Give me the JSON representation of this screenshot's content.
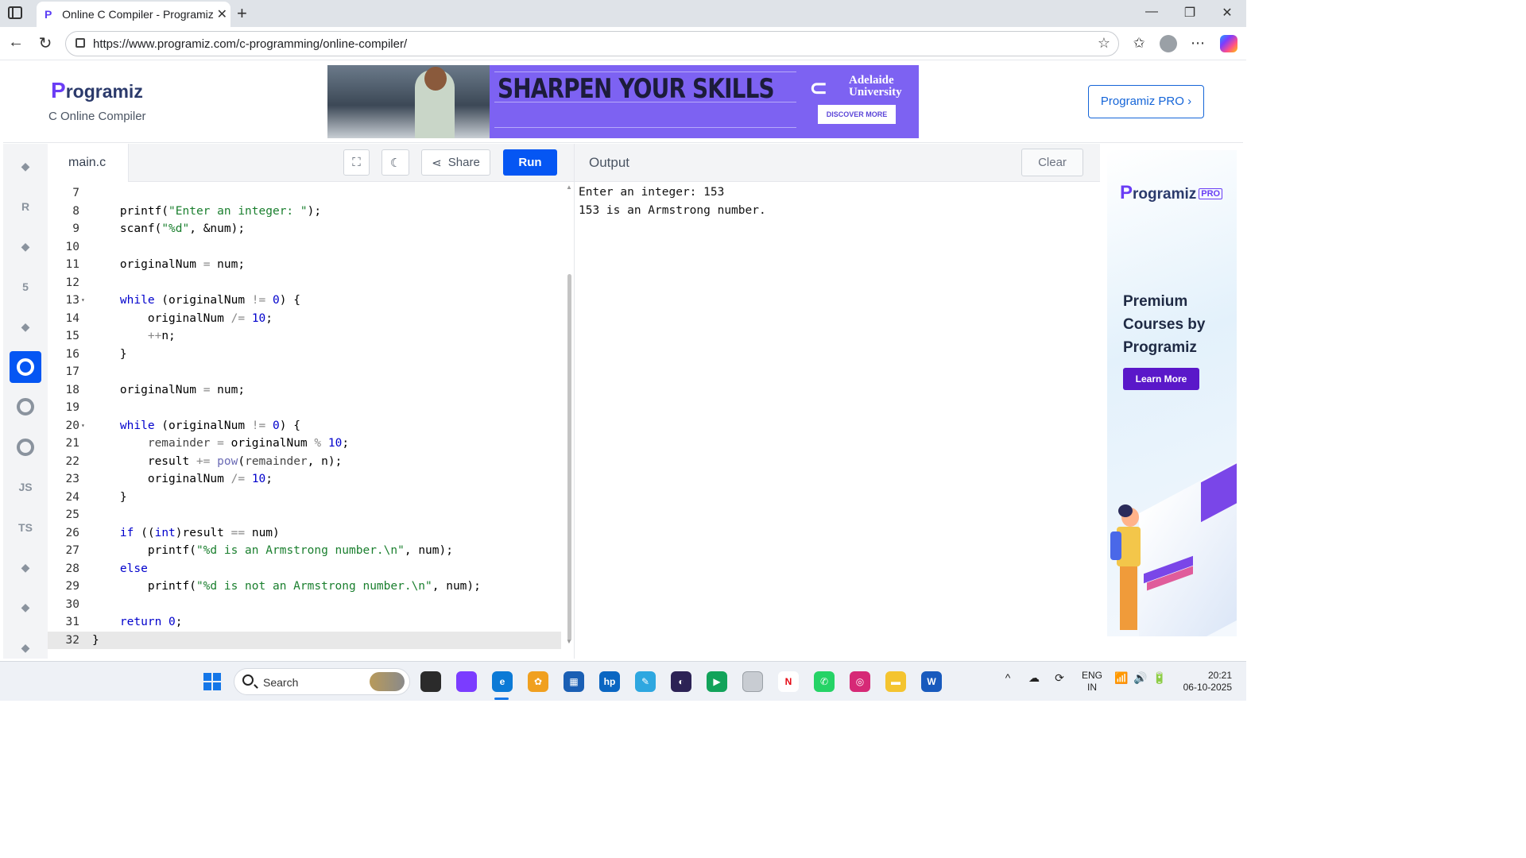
{
  "browser": {
    "tab_title": "Online C Compiler - Programiz",
    "tab_close": "✕",
    "new_tab": "+",
    "url": "https://www.programiz.com/c-programming/online-compiler/",
    "window_controls": [
      "—",
      "❐",
      "✕"
    ],
    "nav": [
      "←",
      "↻"
    ],
    "toolbar_icons": [
      "☆",
      "✩",
      "⋯"
    ]
  },
  "header": {
    "logo_initial": "P",
    "logo_rest": "rogramiz",
    "subtitle": "C Online Compiler",
    "pro_button": "Programiz PRO ›"
  },
  "banner": {
    "headline": "SHARPEN YOUR SKILLS",
    "university_line1": "Adelaide",
    "university_line2": "University",
    "cta": "DISCOVER MORE"
  },
  "sidebar": {
    "items": [
      {
        "name": "python",
        "label": "",
        "active": false
      },
      {
        "name": "r",
        "label": "R",
        "active": false
      },
      {
        "name": "sql",
        "label": "",
        "active": false
      },
      {
        "name": "html",
        "label": "5",
        "active": false
      },
      {
        "name": "java",
        "label": "",
        "active": false
      },
      {
        "name": "c",
        "label": "C",
        "active": true
      },
      {
        "name": "cpp",
        "label": "C",
        "active": false
      },
      {
        "name": "csharp",
        "label": "C",
        "active": false
      },
      {
        "name": "js",
        "label": "JS",
        "active": false
      },
      {
        "name": "ts",
        "label": "TS",
        "active": false
      },
      {
        "name": "go",
        "label": "",
        "active": false
      },
      {
        "name": "swift",
        "label": "",
        "active": false
      },
      {
        "name": "rust",
        "label": "",
        "active": false
      }
    ]
  },
  "editor": {
    "filename": "main.c",
    "share_label": "Share",
    "run_label": "Run",
    "lines": [
      {
        "n": "7",
        "fold": false,
        "html": ""
      },
      {
        "n": "8",
        "fold": false,
        "html": "    printf(<span class=\"str\">\"Enter an integer: \"</span>);"
      },
      {
        "n": "9",
        "fold": false,
        "html": "    scanf(<span class=\"str\">\"%d\"</span>, &amp;num);"
      },
      {
        "n": "10",
        "fold": false,
        "html": ""
      },
      {
        "n": "11",
        "fold": false,
        "html": "    originalNum <span class=\"op\">=</span> num;"
      },
      {
        "n": "12",
        "fold": false,
        "html": ""
      },
      {
        "n": "13",
        "fold": true,
        "html": "    <span class=\"kw\">while</span> (originalNum <span class=\"op\">!=</span> <span class=\"num\">0</span>) {"
      },
      {
        "n": "14",
        "fold": false,
        "html": "        originalNum <span class=\"op\">/=</span> <span class=\"num\">10</span>;"
      },
      {
        "n": "15",
        "fold": false,
        "html": "        <span class=\"op\">++</span>n;"
      },
      {
        "n": "16",
        "fold": false,
        "html": "    }"
      },
      {
        "n": "17",
        "fold": false,
        "html": ""
      },
      {
        "n": "18",
        "fold": false,
        "html": "    originalNum <span class=\"op\">=</span> num;"
      },
      {
        "n": "19",
        "fold": false,
        "html": ""
      },
      {
        "n": "20",
        "fold": true,
        "html": "    <span class=\"kw\">while</span> (originalNum <span class=\"op\">!=</span> <span class=\"num\">0</span>) {"
      },
      {
        "n": "21",
        "fold": false,
        "html": "        <span class=\"idn\">remainder</span> <span class=\"op\">=</span> originalNum <span class=\"op\">%</span> <span class=\"num\">10</span>;"
      },
      {
        "n": "22",
        "fold": false,
        "html": "        result <span class=\"op\">+=</span> <span class=\"fn\">pow</span>(<span class=\"idn\">remainder</span>, n);"
      },
      {
        "n": "23",
        "fold": false,
        "html": "        originalNum <span class=\"op\">/=</span> <span class=\"num\">10</span>;"
      },
      {
        "n": "24",
        "fold": false,
        "html": "    }"
      },
      {
        "n": "25",
        "fold": false,
        "html": ""
      },
      {
        "n": "26",
        "fold": false,
        "html": "    <span class=\"kw\">if</span> ((<span class=\"kw\">int</span>)result <span class=\"op\">==</span> num)"
      },
      {
        "n": "27",
        "fold": false,
        "html": "        printf(<span class=\"str\">\"%d is an Armstrong number.\\n\"</span>, num);"
      },
      {
        "n": "28",
        "fold": false,
        "html": "    <span class=\"kw\">else</span>"
      },
      {
        "n": "29",
        "fold": false,
        "html": "        printf(<span class=\"str\">\"%d is not an Armstrong number.\\n\"</span>, num);"
      },
      {
        "n": "30",
        "fold": false,
        "html": ""
      },
      {
        "n": "31",
        "fold": false,
        "html": "    <span class=\"kw\">return</span> <span class=\"num\">0</span>;"
      },
      {
        "n": "32",
        "fold": false,
        "html": "}"
      }
    ],
    "current_line": "32"
  },
  "output": {
    "title": "Output",
    "clear_label": "Clear",
    "lines": [
      "Enter an integer: 153",
      "153 is an Armstrong number."
    ]
  },
  "right_ad": {
    "logo_initial": "P",
    "logo_rest": "rogramiz",
    "pro_tag": "PRO",
    "heading": "Premium Courses by Programiz",
    "cta": "Learn More"
  },
  "taskbar": {
    "search_placeholder": "Search",
    "language_line1": "ENG",
    "language_line2": "IN",
    "time": "20:21",
    "date": "06-10-2025",
    "apps": [
      {
        "name": "task-view",
        "color": "#2b2b2b",
        "glyph": ""
      },
      {
        "name": "copilot",
        "color": "#7b3cff",
        "glyph": ""
      },
      {
        "name": "edge",
        "color": "#0c7ad6",
        "glyph": "e"
      },
      {
        "name": "photos",
        "color": "#f0a020",
        "glyph": "✿"
      },
      {
        "name": "store",
        "color": "#1a5fb4",
        "glyph": "▦"
      },
      {
        "name": "hp",
        "color": "#0a66c2",
        "glyph": "hp"
      },
      {
        "name": "bing",
        "color": "#2ea7e0",
        "glyph": "✎"
      },
      {
        "name": "eclipse",
        "color": "#2c2255",
        "glyph": "◐"
      },
      {
        "name": "meet",
        "color": "#12a35a",
        "glyph": "▶"
      },
      {
        "name": "file",
        "color": "#c8ccd2",
        "glyph": ""
      },
      {
        "name": "netflix",
        "color": "#ffffff",
        "glyph": "N"
      },
      {
        "name": "whatsapp",
        "color": "#25d366",
        "glyph": "✆"
      },
      {
        "name": "instagram",
        "color": "#d62976",
        "glyph": "◎"
      },
      {
        "name": "explorer",
        "color": "#f4c430",
        "glyph": "▬"
      },
      {
        "name": "word",
        "color": "#185abd",
        "glyph": "W"
      }
    ],
    "tray_icons": [
      "^",
      "☁",
      "⟳",
      "📶",
      "🔊",
      "🔋"
    ]
  }
}
